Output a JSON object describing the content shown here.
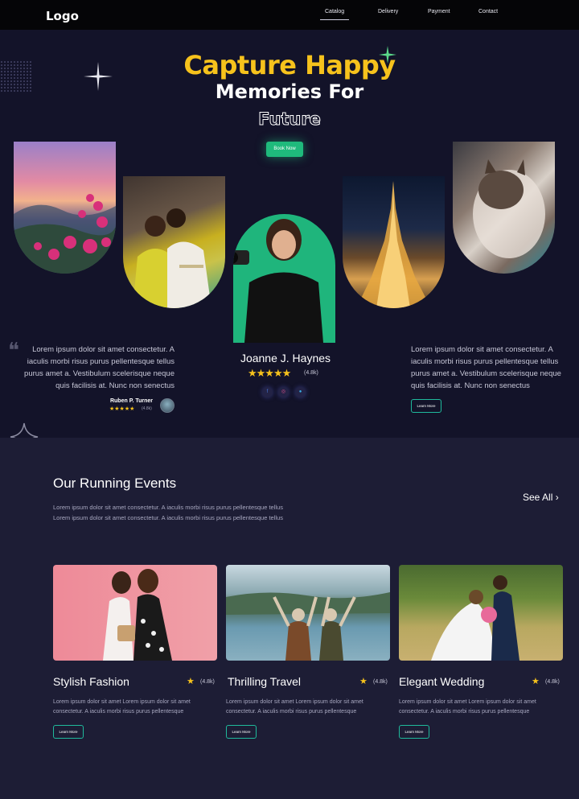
{
  "nav": {
    "logo": "Logo",
    "links": [
      "Catalog",
      "Delivery",
      "Payment",
      "Contact"
    ],
    "active": "Catalog"
  },
  "hero": {
    "title_line1": "Capture Happy",
    "title_line2": "Memories For",
    "title_line3": "Future",
    "book_label": "Book Now",
    "testimonial": {
      "text": "Lorem ipsum dolor sit amet consectetur. A iaculis morbi risus purus pellentesque tellus purus amet a. Vestibulum scelerisque neque quis facilisis at. Nunc non senectus",
      "name": "Ruben P. Turner",
      "stars": "★★★★★",
      "rating": "(4.8k)"
    },
    "featured": {
      "name": "Joanne J. Haynes",
      "stars": "★★★★★",
      "rating": "(4.8k)"
    },
    "right": {
      "text": "Lorem ipsum dolor sit amet consectetur. A iaculis morbi risus purus pellentesque tellus purus amet a. Vestibulum scelerisque neque quis facilisis at. Nunc non senectus",
      "learn_label": "Learn More"
    }
  },
  "events": {
    "title": "Our Running Events",
    "description": "Lorem ipsum dolor sit amet consectetur. A iaculis morbi risus purus pellentesque tellus  Lorem ipsum dolor sit amet consectetur. A iaculis morbi risus purus pellentesque tellus",
    "see_all": "See All",
    "cards": [
      {
        "title": "Stylish Fashion",
        "rating": "(4.8k)",
        "desc": "Lorem ipsum dolor sit amet Lorem ipsum dolor sit amet consectetur. A iaculis morbi risus purus pellentesque",
        "learn": "Learn More"
      },
      {
        "title": "Thrilling Travel",
        "rating": "(4.8k)",
        "desc": "Lorem ipsum dolor sit amet Lorem ipsum dolor sit amet consectetur. A iaculis morbi risus purus pellentesque",
        "learn": "Learn More"
      },
      {
        "title": "Elegant Wedding",
        "rating": "(4.8k)",
        "desc": "Lorem ipsum dolor sit amet Lorem ipsum dolor sit amet consectetur. A iaculis morbi risus purus pellentesque",
        "learn": "Learn More"
      }
    ]
  },
  "icons": {
    "quote": "quote-icon",
    "star": "star-icon",
    "facebook": "facebook-icon",
    "instagram": "instagram-icon",
    "twitter": "twitter-icon",
    "chevron": "chevron-right-icon",
    "sparkle": "sparkle-icon"
  },
  "colors": {
    "accent_yellow": "#f6c21c",
    "accent_green": "#1fba7c",
    "hero_bg": "#131329",
    "events_bg": "#1d1d35"
  }
}
